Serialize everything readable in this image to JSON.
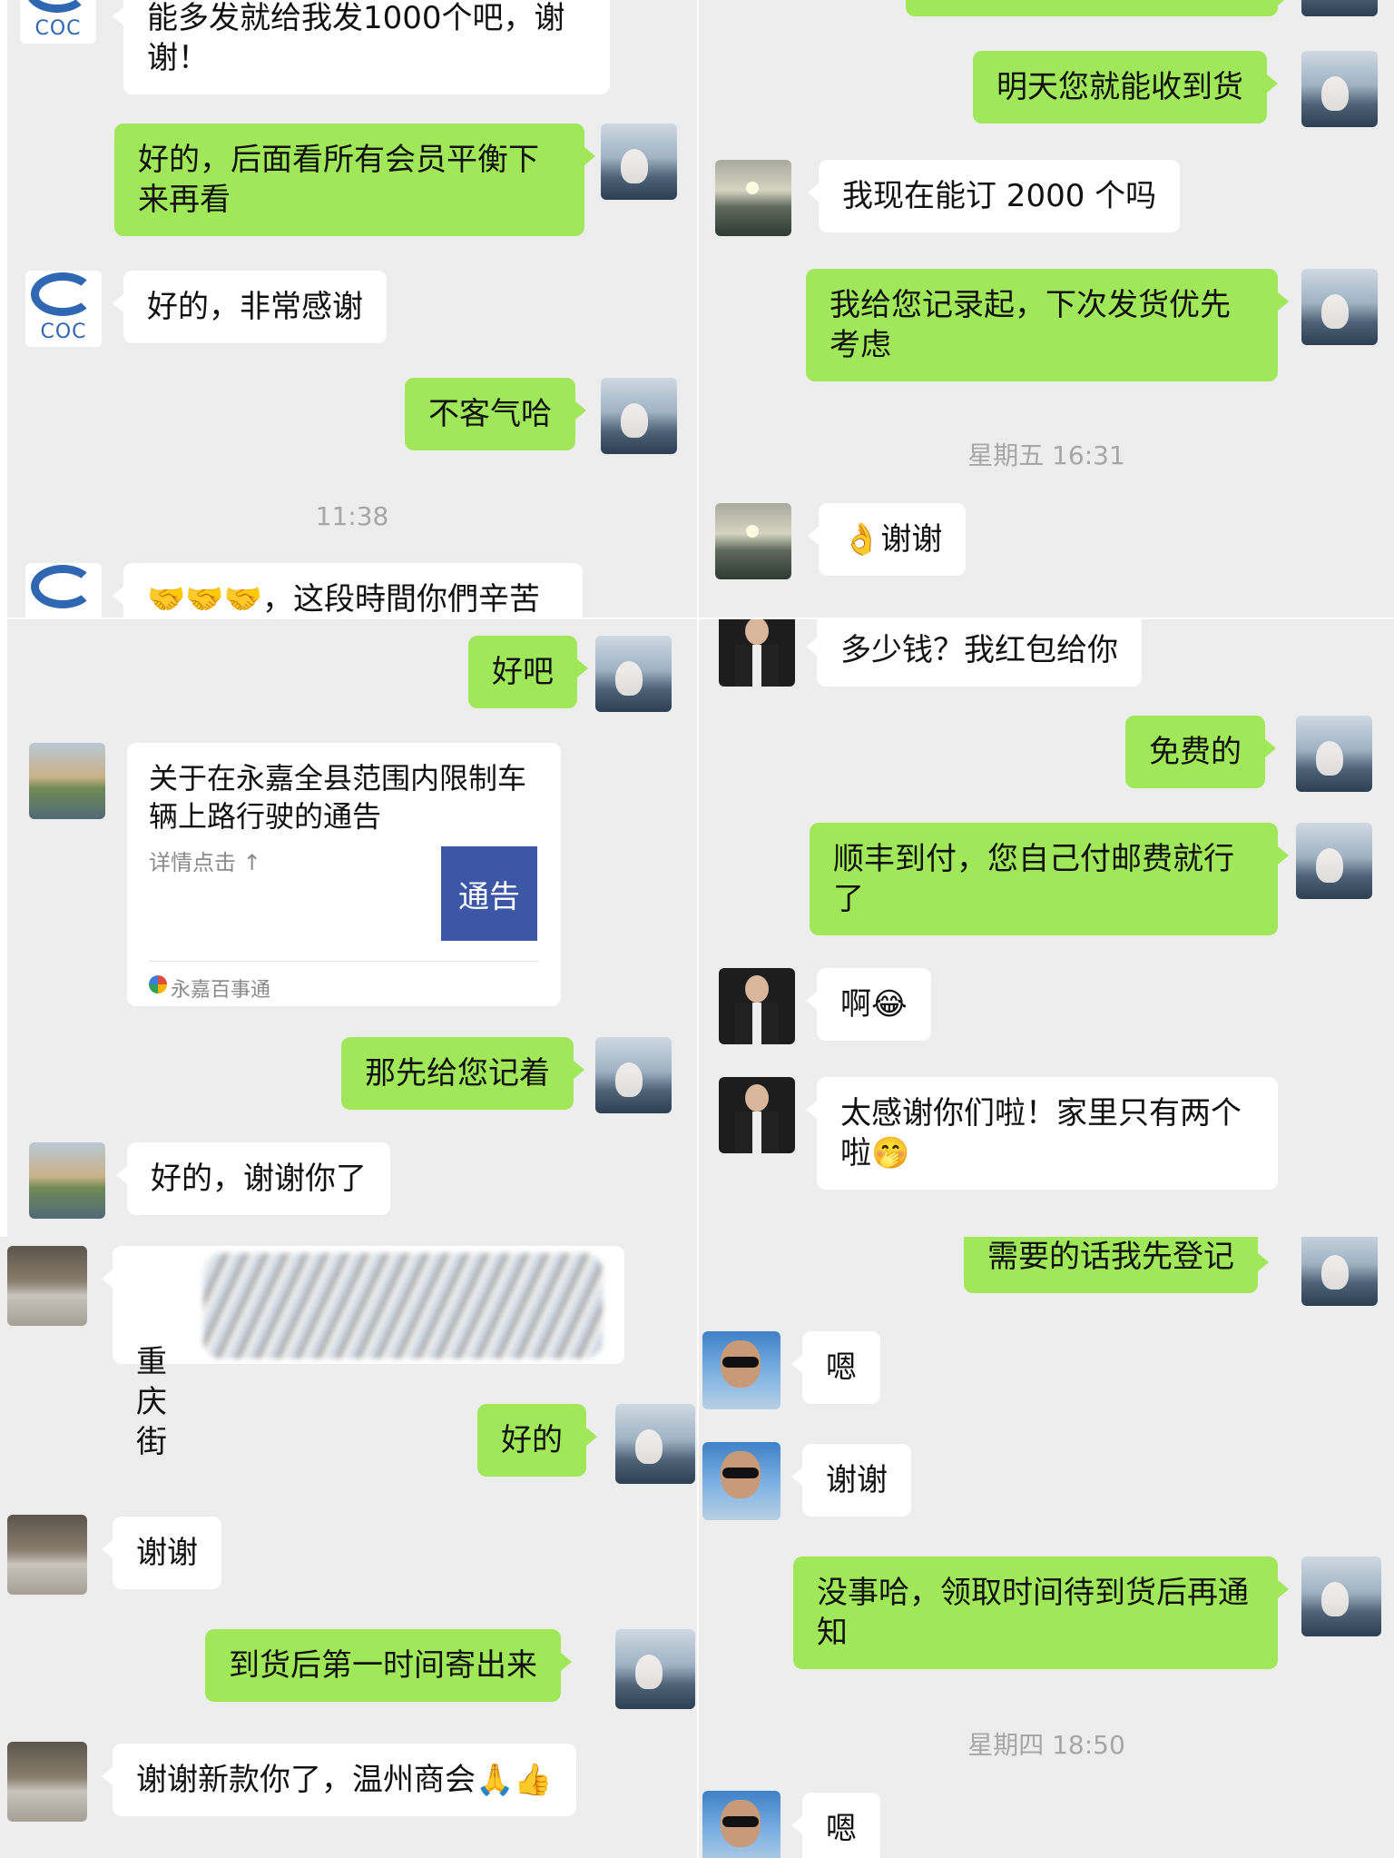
{
  "panel1": {
    "msg_top": "能多发就给我发1000个吧，谢谢！",
    "msg_reply1": "好的，后面看所有会员平衡下来再看",
    "msg_thanks": "好的，非常感谢",
    "msg_welcome": "不客气哈",
    "time": "11:38",
    "msg_bottom": "🤝🤝🤝，这段時間你們辛苦",
    "logo_text": "COC"
  },
  "panel2": {
    "msg_tomorrow": "明天您就能收到货",
    "msg_order": "我现在能订 2000 个吗",
    "msg_record": "我给您记录起，下次发货优先考虑",
    "time": "星期五 16:31",
    "msg_thanks": "👌谢谢"
  },
  "panel3": {
    "msg_ok": "好吧",
    "card": {
      "title": "关于在永嘉全县范围内限制车辆上路行驶的通告",
      "desc": "详情点击 ↑",
      "thumb": "通告",
      "source": "永嘉百事通"
    },
    "msg_note": "那先给您记着",
    "msg_thanks": "好的，谢谢你了"
  },
  "panel4": {
    "msg_price": "多少钱？我红包给你",
    "msg_free": "免费的",
    "msg_shipping": "顺丰到付，您自己付邮费就行了",
    "msg_ah": "啊😂",
    "msg_thankyou": "太感谢你们啦！家里只有两个啦🤭"
  },
  "panel5": {
    "msg_address": "重庆 街",
    "msg_ok": "好的",
    "msg_thanks": "谢谢",
    "msg_ship": "到货后第一时间寄出来",
    "msg_final": "谢谢新款你了，温州商会🙏👍"
  },
  "panel6": {
    "msg_register": "需要的话我先登记",
    "msg_en1": "嗯",
    "msg_thanks": "谢谢",
    "msg_notify": "没事哈，领取时间待到货后再通知",
    "time": "星期四 18:50",
    "msg_en2": "嗯"
  }
}
